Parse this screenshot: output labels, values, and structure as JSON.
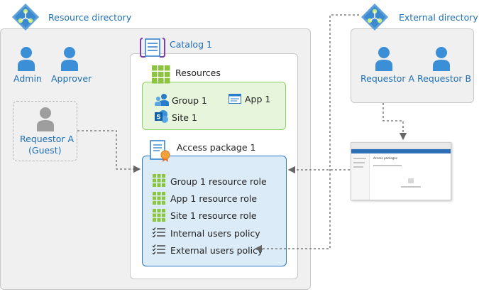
{
  "resource_directory": {
    "label": "Resource directory"
  },
  "external_directory": {
    "label": "External directory"
  },
  "catalog": {
    "label": "Catalog 1"
  },
  "resource_users": [
    {
      "label": "Admin"
    },
    {
      "label": "Approver"
    }
  ],
  "guest": {
    "line1": "Requestor A",
    "line2": "(Guest)"
  },
  "external_users": [
    {
      "label": "Requestor A"
    },
    {
      "label": "Requestor B"
    }
  ],
  "resources": {
    "title": "Resources",
    "items": [
      {
        "label": "Group 1",
        "icon": "group-icon"
      },
      {
        "label": "App 1",
        "icon": "app-window-icon"
      },
      {
        "label": "Site 1",
        "icon": "sharepoint-icon"
      }
    ]
  },
  "access_package": {
    "title": "Access package 1",
    "roles": [
      {
        "label": "Group 1 resource role"
      },
      {
        "label": "App 1 resource role"
      },
      {
        "label": "Site 1 resource role"
      }
    ],
    "policies": [
      {
        "label": "Internal users policy"
      },
      {
        "label": "External users policy"
      }
    ]
  },
  "browser": {
    "heading": "Access packages"
  },
  "colors": {
    "accent_blue": "#2a7ccb",
    "resource_green": "#8bd35c",
    "panel_gray": "#f0f0f0"
  }
}
